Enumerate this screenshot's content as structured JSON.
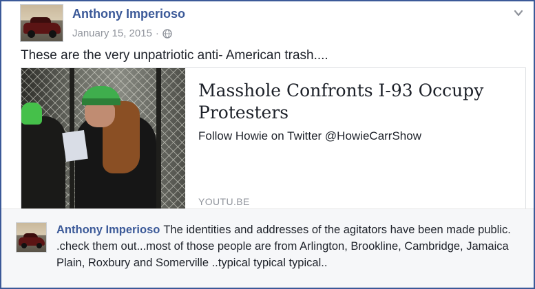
{
  "post": {
    "author": "Anthony Imperioso",
    "date": "January 15, 2015",
    "separator": "·",
    "privacy_icon": "globe-icon",
    "options_icon": "chevron-down-icon",
    "text": "These are the very unpatriotic anti- American trash....",
    "link": {
      "title": "Masshole Confronts I-93 Occupy Protesters",
      "description": "Follow Howie on Twitter @HowieCarrShow",
      "source": "YOUTU.BE"
    }
  },
  "comment": {
    "author": "Anthony Imperioso",
    "text": "The identities and addresses of the agitators have been made public. .check them out...most of those people are from Arlington, Brookline, Cambridge, Jamaica Plain, Roxbury and Somerville ..typical typical typical.."
  },
  "colors": {
    "frame_border": "#3b5998",
    "name_link": "#3b5998",
    "meta_text": "#90949c",
    "comment_background": "#f6f7f9"
  }
}
